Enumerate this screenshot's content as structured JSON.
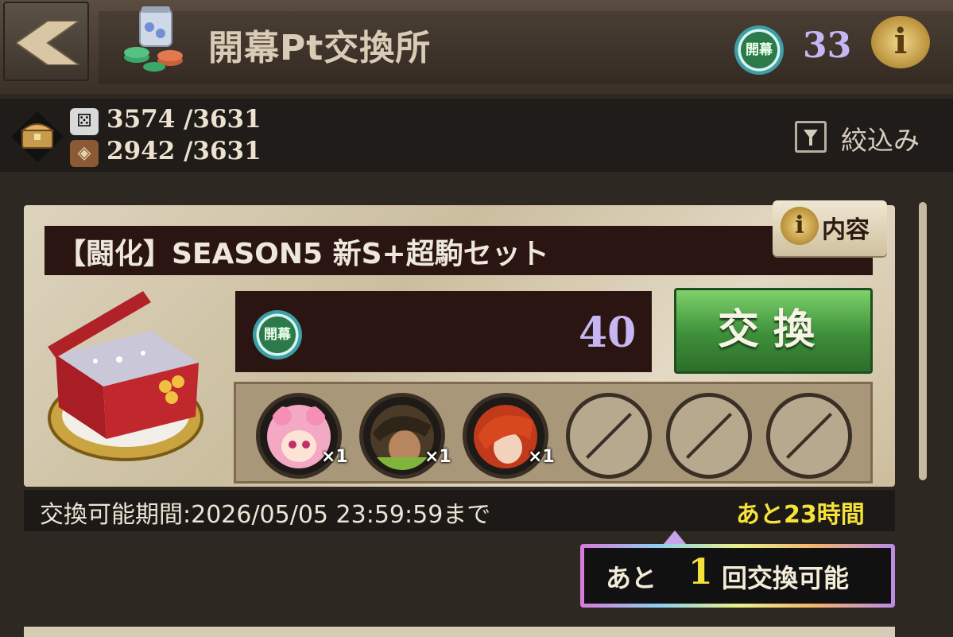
{
  "header": {
    "title": "開幕Pt交換所",
    "point_icon": "開幕",
    "point_count": "33",
    "info_icon": "i"
  },
  "resources": {
    "first": {
      "icon": "dice-icon",
      "value": "3574 /3631"
    },
    "second": {
      "icon": "diamond-icon",
      "value": "2942 /3631"
    },
    "filter_label": "絞込み"
  },
  "item": {
    "title": "【闘化】SEASON5 新S+超駒セット",
    "detail_icon": "i",
    "detail_label": "内容",
    "cost_icon": "開幕",
    "cost": "40",
    "exchange_label": "交換",
    "rewards": [
      {
        "qty": "×1"
      },
      {
        "qty": "×1"
      },
      {
        "qty": "×1"
      }
    ],
    "period": "交換可能期間:2026/05/05 23:59:59まで",
    "remaining": "あと23時間",
    "limit_pre": "あと",
    "limit_count": "1",
    "limit_post": "回交換可能"
  },
  "colors": {
    "accent_green": "#3d8f3a",
    "point_purple": "#c6b6f3",
    "highlight_yellow": "#f5e23a"
  }
}
